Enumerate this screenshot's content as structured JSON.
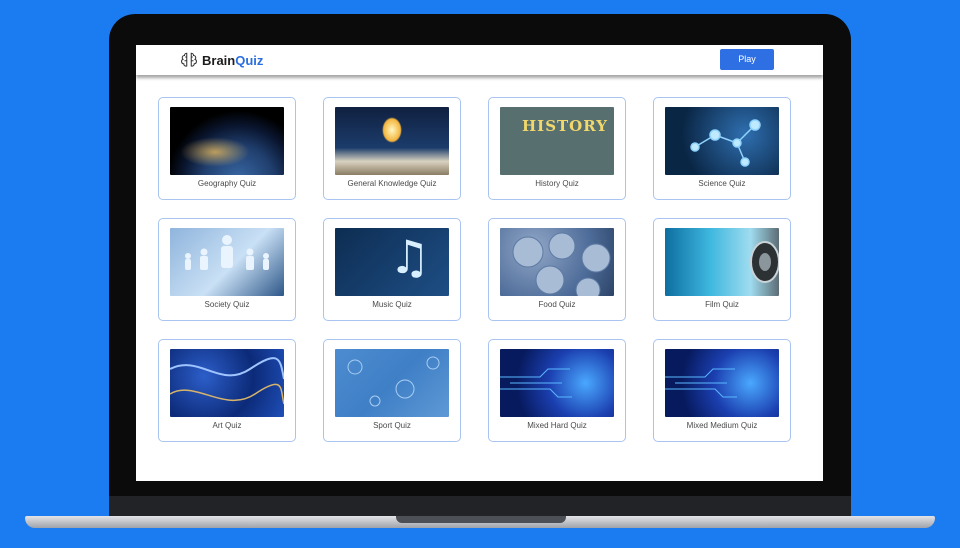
{
  "app": {
    "logo_prefix": "Brain",
    "logo_accent": "Quiz",
    "play_label": "Play",
    "accent_color": "#2f6fe4",
    "background_color": "#1a7cf0"
  },
  "quizzes": [
    {
      "label": "Geography Quiz",
      "icon": "earth-image"
    },
    {
      "label": "General Knowledge Quiz",
      "icon": "book-lightbulb-image"
    },
    {
      "label": "History Quiz",
      "icon": "history-book-image"
    },
    {
      "label": "Science Quiz",
      "icon": "molecule-image"
    },
    {
      "label": "Society Quiz",
      "icon": "people-image"
    },
    {
      "label": "Music Quiz",
      "icon": "music-note-image"
    },
    {
      "label": "Food Quiz",
      "icon": "berries-image"
    },
    {
      "label": "Film Quiz",
      "icon": "film-reel-image"
    },
    {
      "label": "Art Quiz",
      "icon": "marble-art-image"
    },
    {
      "label": "Sport Quiz",
      "icon": "sport-pattern-image"
    },
    {
      "label": "Mixed Hard Quiz",
      "icon": "ai-head-image"
    },
    {
      "label": "Mixed Medium Quiz",
      "icon": "ai-head-image"
    }
  ]
}
